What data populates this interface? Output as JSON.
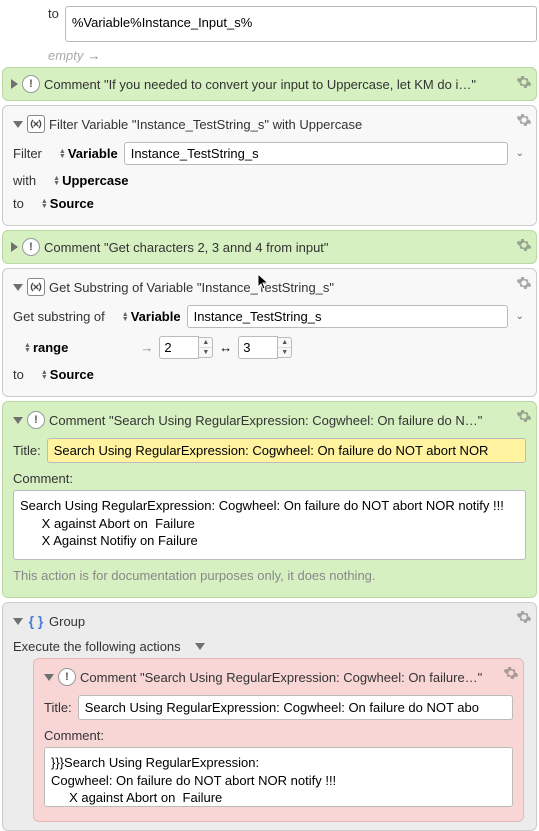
{
  "set_to": {
    "label_to": "to",
    "value": "%Variable%Instance_Input_s%",
    "empty_hint": "empty"
  },
  "comment1": {
    "title": "Comment \"If you needed to convert your input to Uppercase, let KM do i…\""
  },
  "filter": {
    "title": "Filter Variable \"Instance_TestString_s\" with Uppercase",
    "filter_label": "Filter",
    "filter_target_sel": "Variable",
    "variable_value": "Instance_TestString_s",
    "with_label": "with",
    "with_sel": "Uppercase",
    "to_label": "to",
    "to_sel": "Source"
  },
  "comment2": {
    "title": "Comment \"Get characters 2, 3 annd 4 from input\""
  },
  "substring": {
    "title": "Get Substring of Variable \"Instance_TestString_s\"",
    "get_label": "Get substring of",
    "get_sel": "Variable",
    "variable_value": "Instance_TestString_s",
    "range_sel": "range",
    "from_value": "2",
    "to_symbol": "↔",
    "to_value": "3",
    "to_label": "to",
    "to_sel": "Source"
  },
  "comment3": {
    "header": "Comment \"Search Using RegularExpression: Cogwheel: On failure do N…\"",
    "title_label": "Title:",
    "title_value": "Search Using RegularExpression: Cogwheel: On failure do NOT abort NOR",
    "comment_label": "Comment:",
    "comment_body": "Search Using RegularExpression: Cogwheel: On failure do NOT abort NOR notify !!!\n      X against Abort on  Failure\n      X Against Notifiy on Failure",
    "doc_note": "This action is for documentation purposes only, it does nothing."
  },
  "group": {
    "title": "Group",
    "execute_label": "Execute the following actions"
  },
  "comment4": {
    "header": "Comment \"Search Using RegularExpression: Cogwheel: On failure…\"",
    "title_label": "Title:",
    "title_value": "Search Using RegularExpression: Cogwheel: On failure do NOT abo",
    "comment_label": "Comment:",
    "comment_body": "}}}Search Using RegularExpression:\nCogwheel: On failure do NOT abort NOR notify !!!\n     X against Abort on  Failure\n     X Against Notifiy on Failure"
  }
}
